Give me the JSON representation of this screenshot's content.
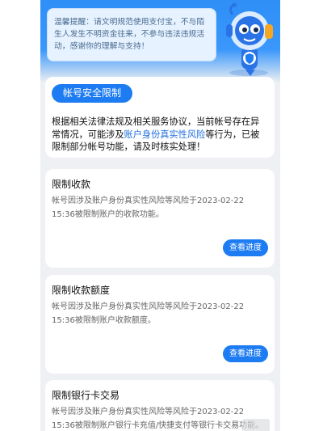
{
  "notice": {
    "text": "温馨提醒：请文明规范使用支付宝，不与陌生人发生不明资金往来，不参与违法违规活动，感谢你的理解与支持！"
  },
  "main": {
    "tag": "帐号安全限制",
    "desc_before": "根据相关法律法规及相关服务协议，当前帐号存在异常情况，可能涉及",
    "desc_highlight": "账户身份真实性风险",
    "desc_after": "等行为，已被限制部分帐号功能，请及时核实处理！"
  },
  "limits": [
    {
      "title": "限制收款",
      "body": "帐号因涉及账户身份真实性风险等风险于2023-02-22 15:36被限制账户的收款功能。",
      "button": "查看进度"
    },
    {
      "title": "限制收款额度",
      "body": "帐号因涉及账户身份真实性风险等风险于2023-02-22 15:36被限制账户收款额度。",
      "button": "查看进度"
    },
    {
      "title": "限制银行卡交易",
      "body": "帐号因涉及账户身份真实性风险等风险于2023-02-22 15:36被限制账户银行卡充值/快捷支付等银行卡交易功能。"
    }
  ],
  "colors": {
    "primary": "#1e7cf2",
    "header": "#2f8ff7",
    "highlight": "#1e6fe0",
    "page_bg": "#eef0f3"
  }
}
